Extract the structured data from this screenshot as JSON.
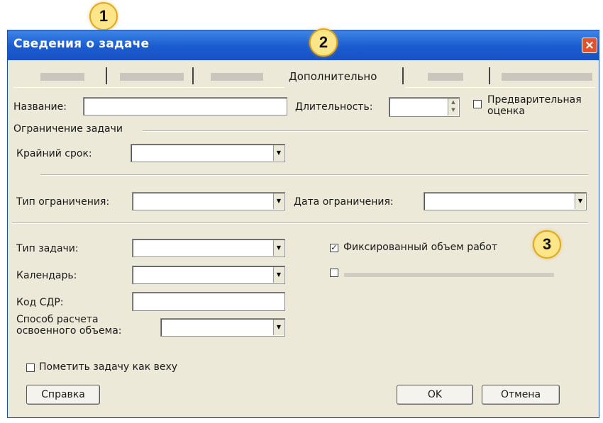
{
  "callouts": {
    "one": "1",
    "two": "2",
    "three": "3"
  },
  "dialog": {
    "title": "Сведения о задаче",
    "close_icon": "×",
    "active_tab": "Дополнительно"
  },
  "fields": {
    "name_label": "Название:",
    "name_value": "",
    "duration_label": "Длительность:",
    "duration_value": "",
    "estimate_label_line1": "Предварительная",
    "estimate_label_line2": "оценка",
    "constraint_group": "Ограничение задачи",
    "deadline_label": "Крайний срок:",
    "constraint_type_label": "Тип ограничения:",
    "constraint_date_label": "Дата ограничения:",
    "task_type_label": "Тип задачи:",
    "calendar_label": "Календарь:",
    "wbs_label": "Код СДР:",
    "earned_value_label_line1": "Способ расчета",
    "earned_value_label_line2": "освоенного объема:",
    "effort_driven_label": "Фиксированный объем работ",
    "effort_driven_checked": "✓",
    "milestone_label": "Пометить задачу как веху"
  },
  "buttons": {
    "help": "Справка",
    "ok": "OK",
    "cancel": "Отмена"
  },
  "icons": {
    "combo_arrow": "▼",
    "spin_up": "▲",
    "spin_down": "▼"
  },
  "colors": {
    "titlebar": "#1a5bd0",
    "dialog_bg": "#ece9d8",
    "callout": "#fde68a"
  }
}
